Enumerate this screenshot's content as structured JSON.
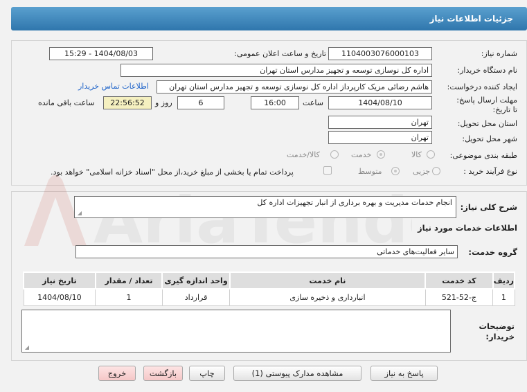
{
  "header": {
    "title": "جزئیات اطلاعات نیاز"
  },
  "fields": {
    "need_number_label": "شماره نیاز:",
    "need_number": "1104003076000103",
    "announce_label": "تاریخ و ساعت اعلان عمومی:",
    "announce_value": "1404/08/03 - 15:29",
    "buyer_org_label": "نام دستگاه خریدار:",
    "buyer_org": "اداره کل نوسازی  توسعه و تجهیز مدارس استان تهران",
    "creator_label": "ایجاد کننده درخواست:",
    "creator": "هاشم رضائی مزیک کارپرداز اداره کل نوسازی  توسعه و تجهیز مدارس استان تهران",
    "contact_link": "اطلاعات تماس خریدار",
    "deadline_label": "مهلت ارسال پاسخ: تا تاریخ:",
    "deadline_date": "1404/08/10",
    "time_label": "ساعت",
    "deadline_time": "16:00",
    "days_value": "6",
    "days_label": "روز و",
    "remaining_value": "22:56:52",
    "remaining_label": "ساعت باقی مانده",
    "province_label": "استان محل تحویل:",
    "province": "تهران",
    "city_label": "شهر محل تحویل:",
    "city": "تهران",
    "category_label": "طبقه بندی موضوعی:",
    "category_options": [
      "کالا",
      "خدمت",
      "کالا/خدمت"
    ],
    "process_label": "نوع فرآیند خرید :",
    "process_options": [
      "جزیی",
      "متوسط"
    ],
    "payment_note": "پرداخت تمام یا بخشی از مبلغ خرید،از محل \"اسناد خزانه اسلامی\" خواهد بود."
  },
  "description": {
    "label": "شرح کلی نیاز:",
    "value": "انجام خدمات مدیریت و بهره برداری از انبار تجهیزات اداره کل"
  },
  "services": {
    "section_title": "اطلاعات خدمات مورد نیاز",
    "group_label": "گروه خدمت:",
    "group_value": "سایر فعالیت‌های خدماتی",
    "columns": [
      "ردیف",
      "کد خدمت",
      "نام خدمت",
      "واحد اندازه گیری",
      "تعداد / مقدار",
      "تاریخ نیاز"
    ],
    "rows": [
      [
        "1",
        "ج-52-521",
        "انبارداری و ذخیره سازی",
        "قرارداد",
        "1",
        "1404/08/10"
      ]
    ]
  },
  "notes": {
    "label": "توضیحات خریدار:",
    "value": ""
  },
  "buttons": {
    "reply": "پاسخ به نیاز",
    "attachments": "مشاهده مدارک پیوستی (1)",
    "print": "چاپ",
    "back": "بازگشت",
    "exit": "خروج"
  },
  "watermark": "AriaTender.net",
  "colors": {
    "header": "#2f76ad",
    "link": "#1e63c9",
    "highlight": "#f5f0c0",
    "exit_button": "#f5c7c7"
  }
}
